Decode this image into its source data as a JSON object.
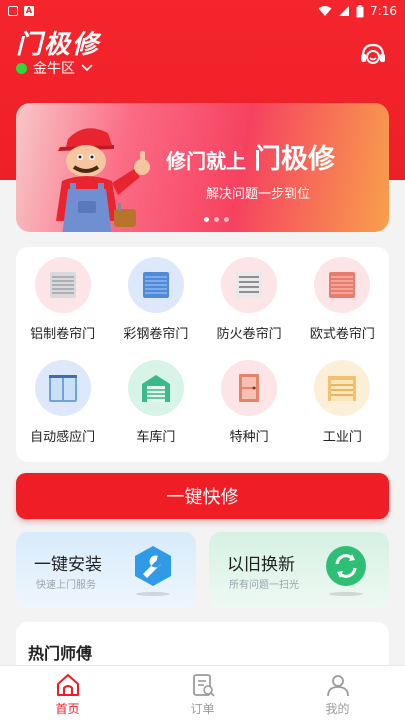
{
  "status_bar": {
    "time": "7:16"
  },
  "header": {
    "app_title": "门极修",
    "location": "金牛区"
  },
  "banner": {
    "headline_small": "修门就上",
    "headline_big": "门极修",
    "subtitle": "解决问题一步到位",
    "dots": 3,
    "active_dot": 0
  },
  "categories": [
    {
      "label": "铝制卷帘门",
      "icon": "aluminum-shutter-icon",
      "bg": "#fde4e6"
    },
    {
      "label": "彩钢卷帘门",
      "icon": "color-steel-shutter-icon",
      "bg": "#dde8fb"
    },
    {
      "label": "防火卷帘门",
      "icon": "fire-shutter-icon",
      "bg": "#fde4e6"
    },
    {
      "label": "欧式卷帘门",
      "icon": "european-shutter-icon",
      "bg": "#fde4e6"
    },
    {
      "label": "自动感应门",
      "icon": "auto-sensor-door-icon",
      "bg": "#dde8fb"
    },
    {
      "label": "车库门",
      "icon": "garage-door-icon",
      "bg": "#d8f3e8"
    },
    {
      "label": "特种门",
      "icon": "special-door-icon",
      "bg": "#fde4e6"
    },
    {
      "label": "工业门",
      "icon": "industrial-door-icon",
      "bg": "#fcefd8"
    }
  ],
  "quick_repair": {
    "label": "一键快修"
  },
  "services": {
    "install": {
      "title": "一键安装",
      "subtitle": "快速上门服务"
    },
    "renew": {
      "title": "以旧换新",
      "subtitle": "所有问题一扫光"
    }
  },
  "hot_masters": {
    "title": "热门师傅"
  },
  "bottom_nav": [
    {
      "label": "首页",
      "icon": "home-icon",
      "active": true
    },
    {
      "label": "订单",
      "icon": "order-icon",
      "active": false
    },
    {
      "label": "我的",
      "icon": "profile-icon",
      "active": false
    }
  ],
  "colors": {
    "brand_red": "#ef1d24",
    "location_dot": "#35d43d"
  }
}
